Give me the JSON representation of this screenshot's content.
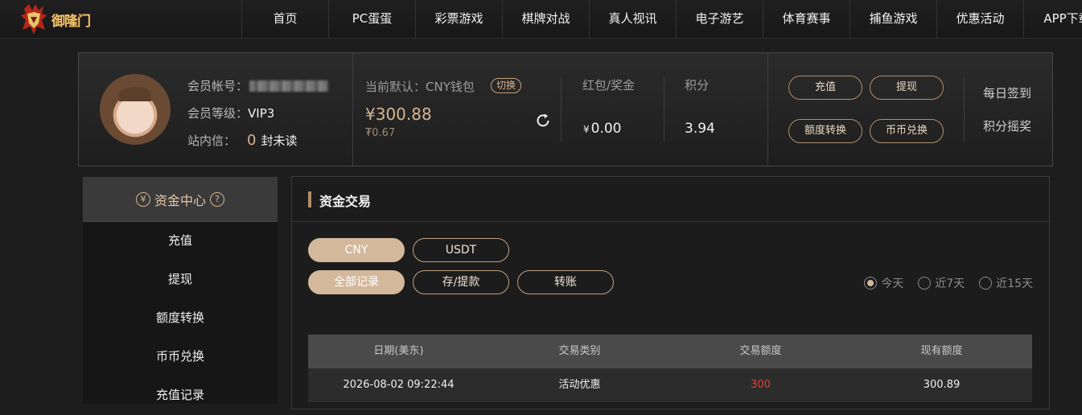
{
  "brand": {
    "logo_text": "御隆门"
  },
  "nav": {
    "items": [
      "首页",
      "PC蛋蛋",
      "彩票游戏",
      "棋牌对战",
      "真人视讯",
      "电子游艺",
      "体育赛事",
      "捕鱼游戏",
      "优惠活动",
      "APP下载"
    ]
  },
  "user": {
    "account_label": "会员帐号：",
    "level_label": "会员等级：",
    "level_value": "VIP3",
    "msg_label": "站内信：",
    "unread_count": "0",
    "unread_suffix": "封未读"
  },
  "wallet": {
    "title": "当前默认：CNY钱包",
    "switch_label": "切换",
    "balance": "¥300.88",
    "usdt_balance": "₮0.67"
  },
  "stats": {
    "bonus_label": "红包/奖金",
    "bonus_symbol": "¥",
    "bonus_value": "0.00",
    "points_label": "积分",
    "points_value": "3.94"
  },
  "actions": {
    "recharge": "充值",
    "withdraw": "提现",
    "transfer": "额度转换",
    "exchange": "币币兑换",
    "daily_signin": "每日签到",
    "points_lottery": "积分摇奖"
  },
  "sidebar": {
    "title": "资金中心",
    "currency_glyph": "¥",
    "help_glyph": "?",
    "items": [
      "充值",
      "提现",
      "额度转换",
      "币币兑换",
      "充值记录"
    ]
  },
  "main": {
    "title": "资金交易",
    "currency_tabs": [
      "CNY",
      "USDT"
    ],
    "type_tabs": [
      "全部记录",
      "存/提款",
      "转账"
    ],
    "ranges": [
      "今天",
      "近7天",
      "近15天"
    ],
    "table": {
      "headers": [
        "日期(美东)",
        "交易类别",
        "交易额度",
        "现有额度"
      ],
      "rows": [
        [
          "2026-08-02 09:22:44",
          "活动优惠",
          "300",
          "300.89"
        ]
      ]
    }
  },
  "colors": {
    "accent": "#d3b89c",
    "negative": "#e0413a"
  }
}
